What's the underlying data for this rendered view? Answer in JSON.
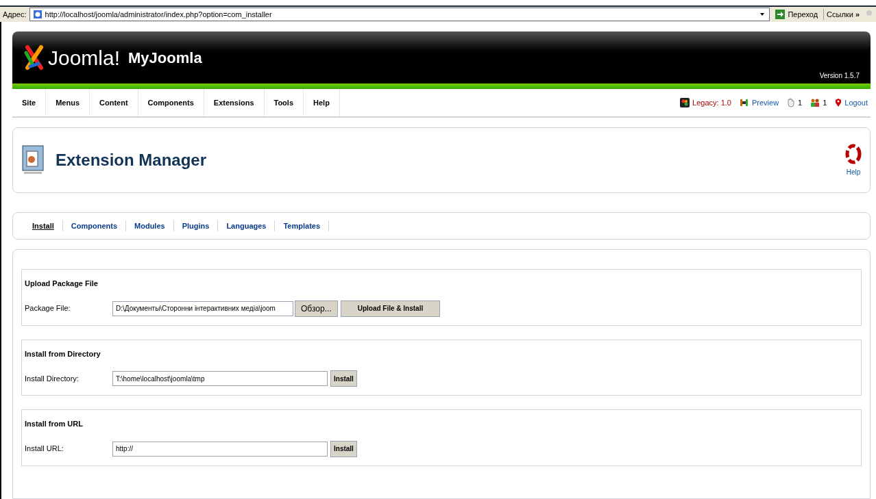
{
  "address_bar": {
    "label": "Адрес:",
    "url": "http://localhost/joomla/administrator/index.php?option=com_installer",
    "go": "Переход",
    "links": "Ссылки",
    "more": "»"
  },
  "header": {
    "logo": "Joomla!",
    "site_name": "MyJoomla",
    "version": "Version 1.5.7"
  },
  "menu": [
    "Site",
    "Menus",
    "Content",
    "Components",
    "Extensions",
    "Tools",
    "Help"
  ],
  "status": [
    {
      "kind": "legacy",
      "text": "Legacy: 1.0"
    },
    {
      "kind": "preview",
      "text": "Preview"
    },
    {
      "kind": "messages",
      "text": "1"
    },
    {
      "kind": "users",
      "text": "1"
    },
    {
      "kind": "logout",
      "text": "Logout"
    }
  ],
  "toolbar": {
    "title": "Extension Manager",
    "help": "Help"
  },
  "tabs": [
    {
      "label": "Install",
      "selected": true
    },
    {
      "label": "Components",
      "selected": false
    },
    {
      "label": "Modules",
      "selected": false
    },
    {
      "label": "Plugins",
      "selected": false
    },
    {
      "label": "Languages",
      "selected": false
    },
    {
      "label": "Templates",
      "selected": false
    }
  ],
  "sections": [
    {
      "title": "Upload Package File",
      "label": "Package File:",
      "value": "D:\\Документы\\Сторонни інтерактивних медіа\\joom",
      "browse": "Обзор...",
      "button": "Upload File & Install"
    },
    {
      "title": "Install from Directory",
      "label": "Install Directory:",
      "value": "T:\\home\\localhost\\joomla\\tmp",
      "button": "Install"
    },
    {
      "title": "Install from URL",
      "label": "Install URL:",
      "value": "http://",
      "button": "Install"
    }
  ]
}
